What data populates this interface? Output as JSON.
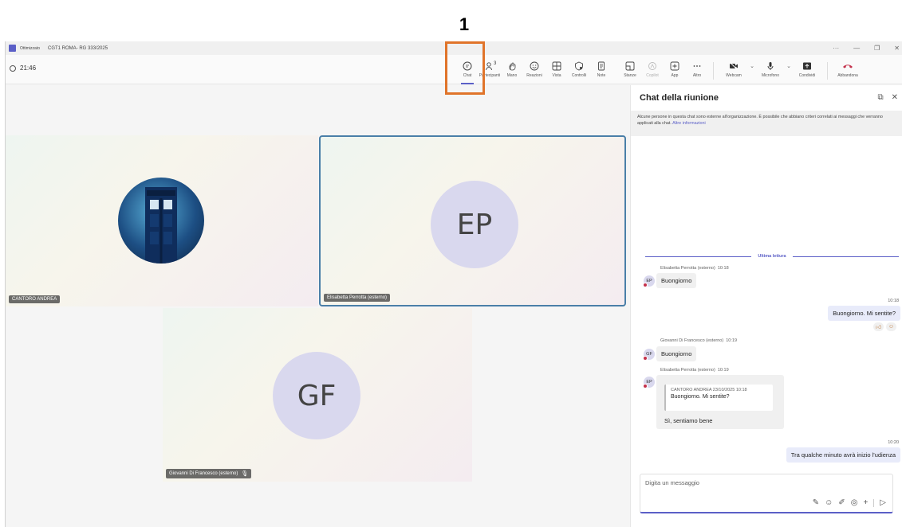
{
  "annotation": {
    "number": "1"
  },
  "window": {
    "title_prefix": "Ottimizzato",
    "title": "CGT1 ROMA- RG 333/2025",
    "controls": {
      "more": "···",
      "minimize": "—",
      "restore": "❐",
      "close": "✕"
    }
  },
  "meeting": {
    "timer": "21:46"
  },
  "toolbar": {
    "chat": "Chat",
    "participants": "Partecipanti",
    "participants_count": "3",
    "hand": "Mano",
    "reactions": "Reazioni",
    "view": "Vista",
    "controls": "Controlli",
    "notes": "Note",
    "rooms": "Stanze",
    "copilot": "Copilot",
    "app": "App",
    "more": "Altro",
    "webcam": "Webcam",
    "microphone": "Microfono",
    "share": "Condividi",
    "leave": "Abbandona",
    "leave_color": "#c4314b",
    "accent_color": "#5b5fc7"
  },
  "participants": [
    {
      "name": "CANTORO ANDREA",
      "avatar": "tardis-photo"
    },
    {
      "name": "Elisabetta Perrotta (esterno)",
      "initials": "EP"
    },
    {
      "name": "Giovanni Di Francesco (esterno)",
      "initials": "GF",
      "muted": true
    }
  ],
  "chat": {
    "title": "Chat della riunione",
    "notice_text": "Alcune persone in questa chat sono esterne all'organizzazione. È possibile che abbiano criteri correlati ai messaggi che verranno applicati alla chat.",
    "notice_link": "Altre informazioni",
    "last_read": "Ultima lettura",
    "messages": [
      {
        "sender": "Elisabetta Perrotta (esterno)",
        "time": "10:18",
        "initials": "EP",
        "text": "Buongiorno"
      },
      {
        "time": "10:18",
        "text": "Buongiorno. Mi sentite?",
        "outgoing": true
      },
      {
        "sender": "Giovanni Di Francesco (esterno)",
        "time": "10:19",
        "initials": "GF",
        "text": "Buongiorno"
      },
      {
        "sender": "Elisabetta Perrotta (esterno)",
        "time": "10:19",
        "initials": "EP",
        "quote_header": "CANTORO ANDREA  23/10/2025 10:18",
        "quote_text": "Buongiorno. Mi sentite?",
        "text": "Sì, sentiamo bene"
      },
      {
        "time": "10:20",
        "text": "Tra qualche minuto avrà inizio l'udienza",
        "outgoing": true
      }
    ],
    "composer_placeholder": "Digita un messaggio"
  }
}
